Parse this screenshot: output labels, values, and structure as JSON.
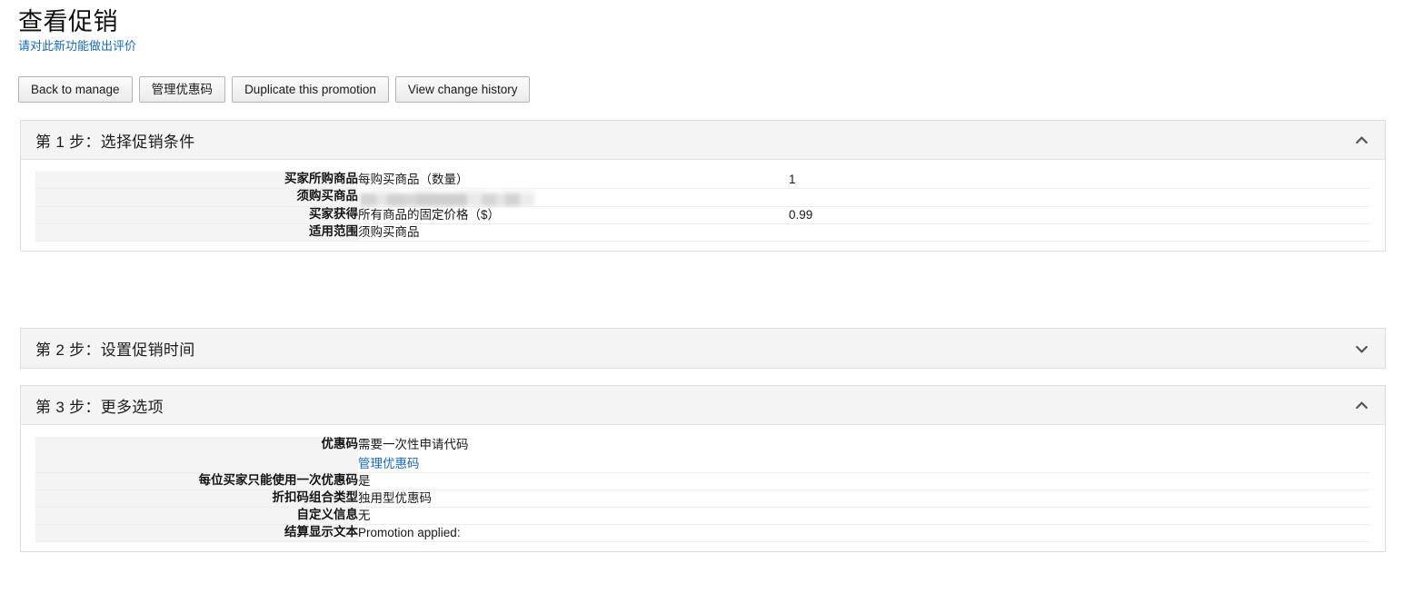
{
  "header": {
    "title": "查看促销",
    "feedback_link": "请对此新功能做出评价"
  },
  "toolbar": {
    "buttons": [
      {
        "label": "Back to manage"
      },
      {
        "label": "管理优惠码"
      },
      {
        "label": "Duplicate this promotion"
      },
      {
        "label": "View change history"
      }
    ]
  },
  "sections": [
    {
      "id": "step-1",
      "title": "第 1 步：选择促销条件",
      "expanded": true,
      "chevron": "chevron-up-icon",
      "rows": [
        {
          "label": "买家所购商品",
          "value": "每购买商品（数量）",
          "number": "1"
        },
        {
          "label": "须购买商品",
          "value": "",
          "number": "",
          "redacted": true
        },
        {
          "label": "买家获得",
          "value": "所有商品的固定价格（$）",
          "number": "0.99"
        },
        {
          "label": "适用范围",
          "value": "须购买商品",
          "number": ""
        }
      ]
    },
    {
      "id": "step-2",
      "title": "第 2 步：设置促销时间",
      "expanded": false,
      "chevron": "chevron-down-icon",
      "rows": []
    },
    {
      "id": "step-3",
      "title": "第 3 步：更多选项",
      "expanded": true,
      "chevron": "chevron-up-icon",
      "rows": [
        {
          "label": "优惠码",
          "value": "需要一次性申请代码",
          "link": "管理优惠码",
          "number": ""
        },
        {
          "label": "每位买家只能使用一次优惠码",
          "value": "是",
          "number": ""
        },
        {
          "label": "折扣码组合类型",
          "value": "独用型优惠码",
          "number": ""
        },
        {
          "label": "自定义信息",
          "value": "无",
          "number": ""
        },
        {
          "label": "结算显示文本",
          "value": "Promotion applied:",
          "number": ""
        }
      ]
    }
  ],
  "colors": {
    "link": "#1669c1",
    "panel_header_bg": "#f4f4f4",
    "panel_border": "#dddddd",
    "label_bg": "#f4f4f4",
    "text": "#111111"
  }
}
